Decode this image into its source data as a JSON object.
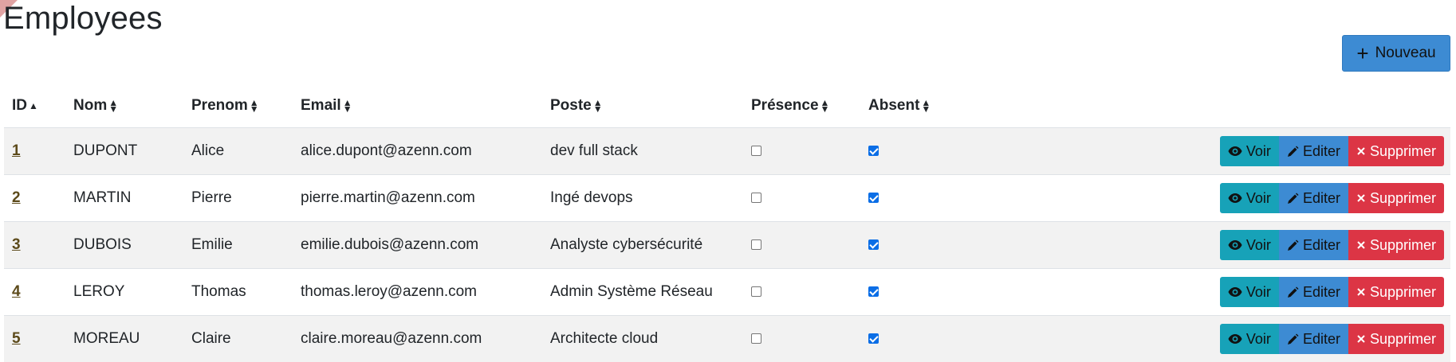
{
  "page": {
    "title": "Employees"
  },
  "toolbar": {
    "new_label": "Nouveau",
    "new_icon": "plus-icon"
  },
  "table": {
    "headers": {
      "id": "ID",
      "nom": "Nom",
      "prenom": "Prenom",
      "email": "Email",
      "poste": "Poste",
      "presence": "Présence",
      "absent": "Absent"
    },
    "sort": {
      "column": "ID",
      "direction": "ascending"
    },
    "rows": [
      {
        "id": "1",
        "nom": "DUPONT",
        "prenom": "Alice",
        "email": "alice.dupont@azenn.com",
        "poste": "dev full stack",
        "presence": false,
        "absent": true
      },
      {
        "id": "2",
        "nom": "MARTIN",
        "prenom": "Pierre",
        "email": "pierre.martin@azenn.com",
        "poste": "Ingé devops",
        "presence": false,
        "absent": true
      },
      {
        "id": "3",
        "nom": "DUBOIS",
        "prenom": "Emilie",
        "email": "emilie.dubois@azenn.com",
        "poste": "Analyste cybersécurité",
        "presence": false,
        "absent": true
      },
      {
        "id": "4",
        "nom": "LEROY",
        "prenom": "Thomas",
        "email": "thomas.leroy@azenn.com",
        "poste": "Admin Système Réseau",
        "presence": false,
        "absent": true
      },
      {
        "id": "5",
        "nom": "MOREAU",
        "prenom": "Claire",
        "email": "claire.moreau@azenn.com",
        "poste": "Architecte cloud",
        "presence": false,
        "absent": true
      }
    ],
    "actions": {
      "view": "Voir",
      "edit": "Editer",
      "delete": "Supprimer"
    }
  },
  "colors": {
    "view": "#17a2b8",
    "edit": "#3d8bd3",
    "delete": "#dc3545",
    "stripe": "#f2f2f2"
  }
}
